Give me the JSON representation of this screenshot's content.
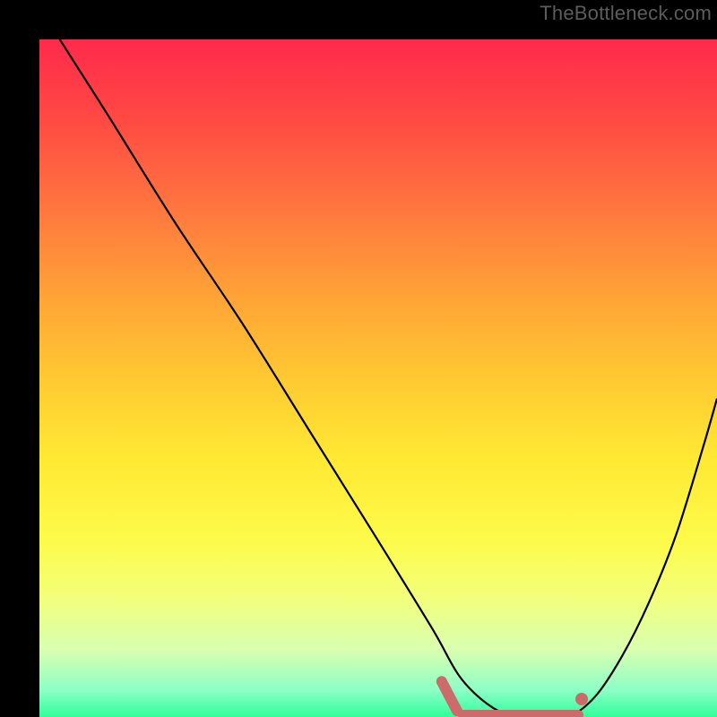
{
  "watermark": "TheBottleneck.com",
  "colors": {
    "curve": "#000000",
    "marker": "#cc6b6b",
    "background": "#000000"
  },
  "chart_data": {
    "type": "line",
    "title": "",
    "xlabel": "",
    "ylabel": "",
    "xlim": [
      0,
      100
    ],
    "ylim": [
      0,
      100
    ],
    "grid": false,
    "legend": false,
    "series": [
      {
        "name": "bottleneck-curve",
        "x": [
          3,
          10,
          20,
          30,
          40,
          50,
          58,
          62,
          66,
          70,
          74,
          78,
          82,
          86,
          90,
          94,
          98,
          100
        ],
        "y": [
          100,
          89,
          73,
          58,
          42,
          26,
          13,
          6,
          2,
          0,
          0,
          0,
          3,
          9,
          17,
          27,
          40,
          47
        ]
      }
    ],
    "annotations": [
      {
        "type": "marker-plateau",
        "x_start": 62,
        "x_end": 80,
        "y": 0
      },
      {
        "type": "marker-dot",
        "x": 80,
        "y": 2
      }
    ]
  }
}
